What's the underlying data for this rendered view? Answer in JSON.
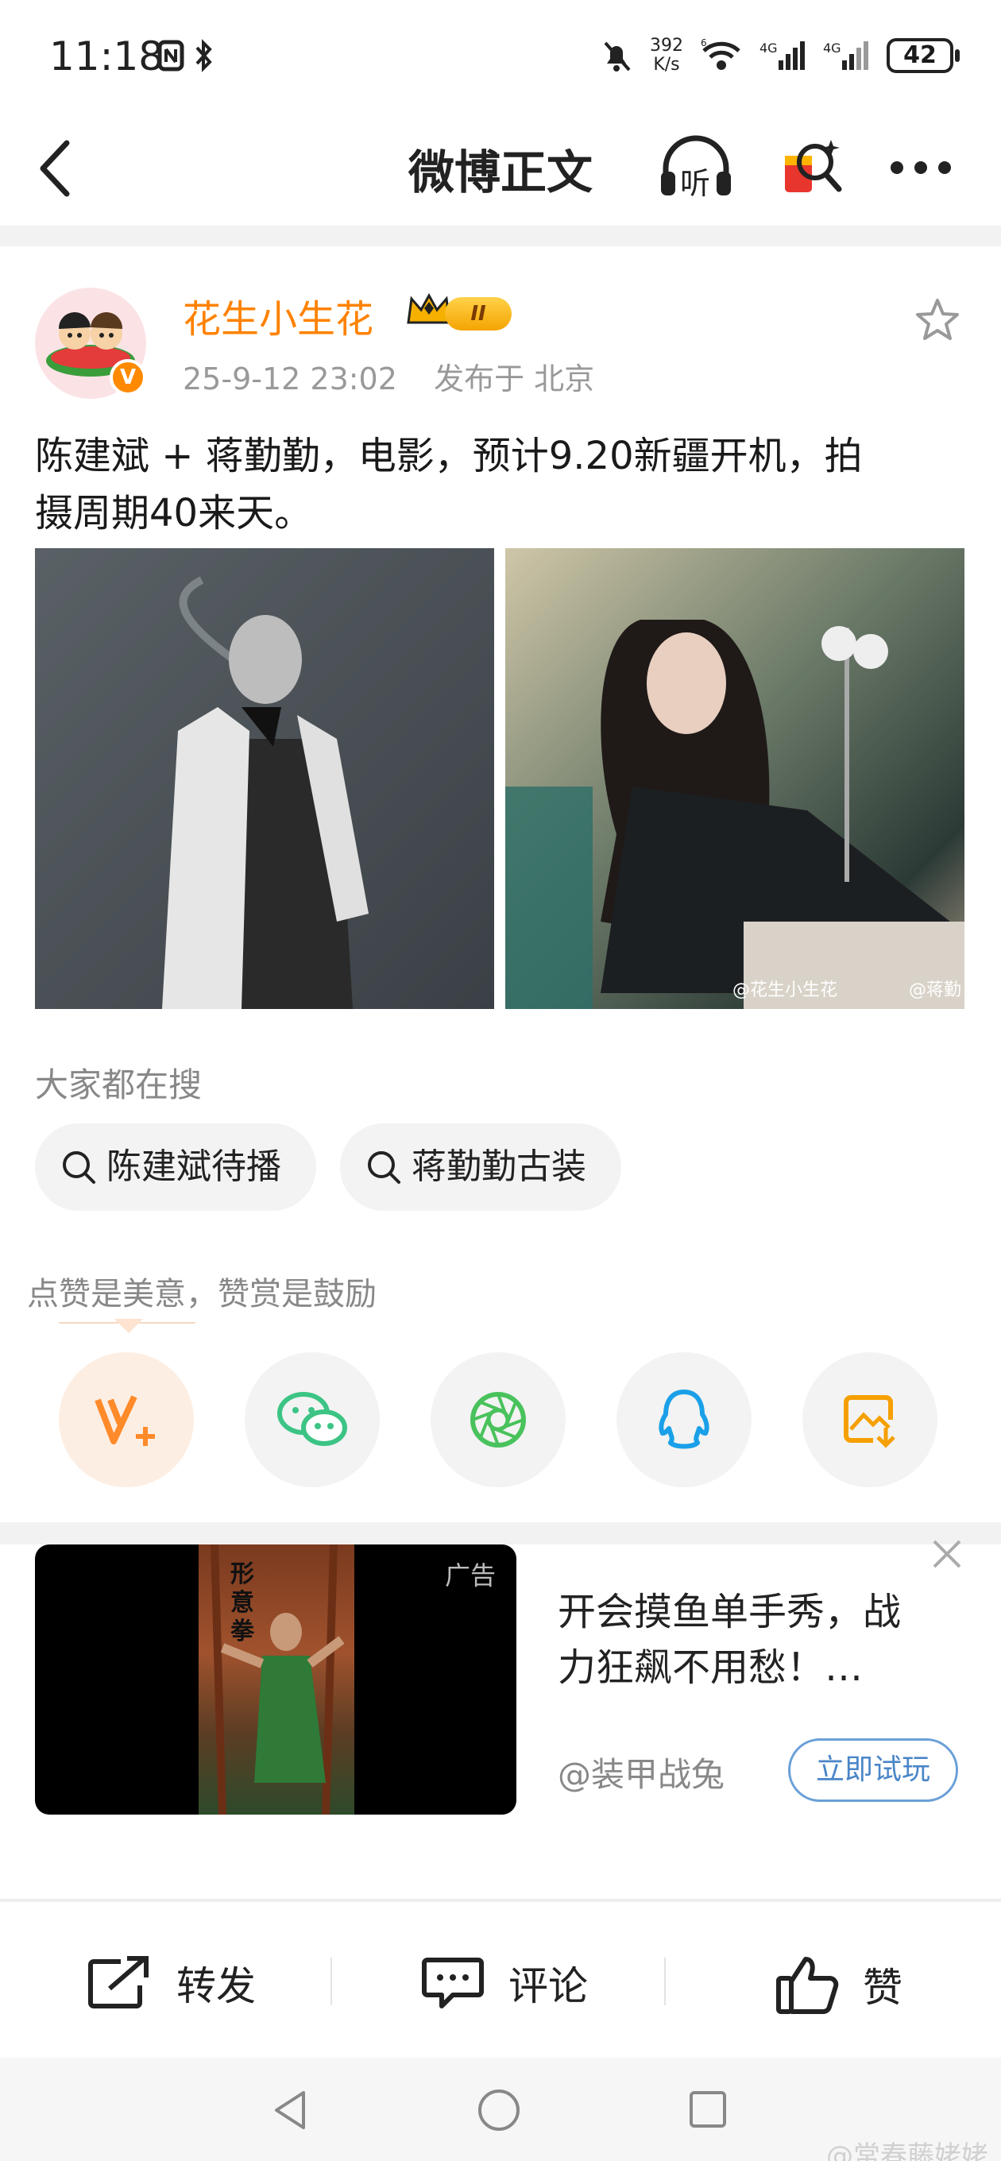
{
  "status_bar": {
    "time": "11:18",
    "net_speed_value": "392",
    "net_speed_unit": "K/s",
    "battery": "42",
    "icons": [
      "nfc-icon",
      "bluetooth-icon",
      "mute-bell-icon",
      "wifi-icon",
      "4g-signal-icon",
      "4g-signal-icon"
    ]
  },
  "header": {
    "title": "微博正文",
    "back_icon": "chevron-left-icon",
    "listen_icon": "headphones-listen-icon",
    "listen_label": "听",
    "red_packet_icon": "red-packet-search-icon",
    "more_icon": "more-dots-icon"
  },
  "post": {
    "username": "花生小生花",
    "level": "II",
    "verified_badge": "V",
    "time": "25-9-12 23:02",
    "location": "发布于 北京",
    "text_line1": "陈建斌 + 蒋勤勤，电影，预计9.20新疆开机，拍",
    "text_line2": "摄周期40来天。",
    "image_watermark_1": "@花生小生花",
    "image_watermark_2": "@蒋勤",
    "favorite_icon": "star-icon"
  },
  "hot_search": {
    "title": "大家都在搜",
    "chips": [
      "陈建斌待播",
      "蒋勤勤古装"
    ]
  },
  "reward": {
    "tip": "点赞是美意，赞赏是鼓励",
    "share_icons": [
      "vplus-reward-icon",
      "wechat-icon",
      "moments-icon",
      "qq-icon",
      "save-image-icon"
    ]
  },
  "ad": {
    "tag": "广告",
    "text_line1": "开会摸鱼单手秀，战",
    "text_line2": "力狂飙不用愁！…",
    "author": "@装甲战兔",
    "button": "立即试玩",
    "poster_text": "形意拳"
  },
  "actions": {
    "repost": "转发",
    "comment": "评论",
    "like": "赞"
  },
  "corner_watermark": "@常春藤姥姥",
  "colors": {
    "brand_orange": "#ff8200",
    "ad_button_blue": "#4a86c8",
    "wechat_green": "#3cc485",
    "qq_blue": "#1aa0e8"
  }
}
